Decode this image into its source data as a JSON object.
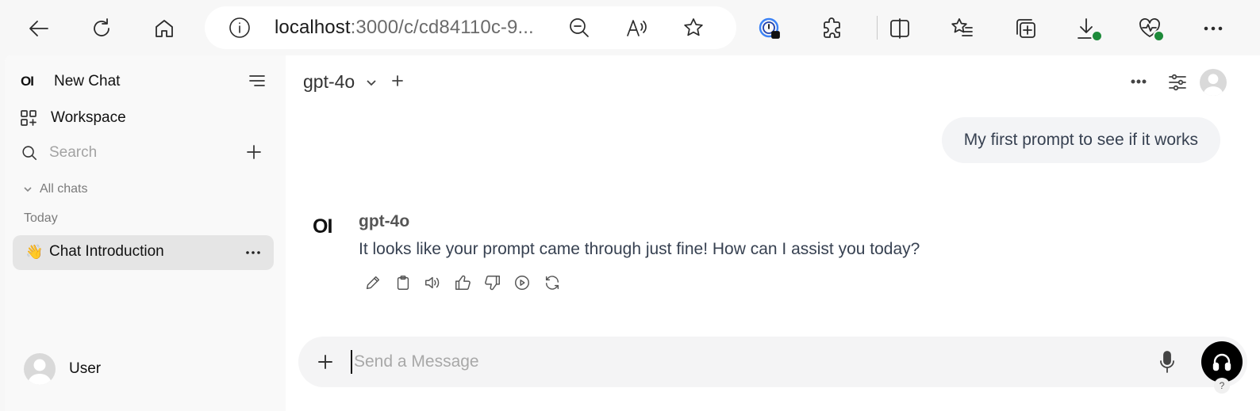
{
  "browser": {
    "url_host": "localhost",
    "url_rest": ":3000/c/cd84110c-9...",
    "icons": [
      "back-icon",
      "refresh-icon",
      "home-icon",
      "info-icon",
      "zoom-out-icon",
      "read-aloud-icon",
      "favorite-star-icon",
      "password-manager-icon",
      "extensions-icon",
      "split-screen-icon",
      "favorites-icon",
      "collections-icon",
      "downloads-icon",
      "browser-essentials-icon",
      "more-icon"
    ],
    "status_color": "#1d8a3a"
  },
  "sidebar": {
    "logo": "OI",
    "new_chat": "New Chat",
    "workspace": "Workspace",
    "search_placeholder": "Search",
    "all_chats": "All chats",
    "group_today": "Today",
    "chat_emoji": "👋",
    "chat_title": "Chat Introduction",
    "user_name": "User"
  },
  "header": {
    "model": "gpt-4o"
  },
  "messages": {
    "user": "My first prompt to see if it works",
    "bot_logo": "OI",
    "bot_name": "gpt-4o",
    "bot_text": "It looks like your prompt came through just fine! How can I assist you today?"
  },
  "composer": {
    "placeholder": "Send a Message"
  },
  "help": "?"
}
